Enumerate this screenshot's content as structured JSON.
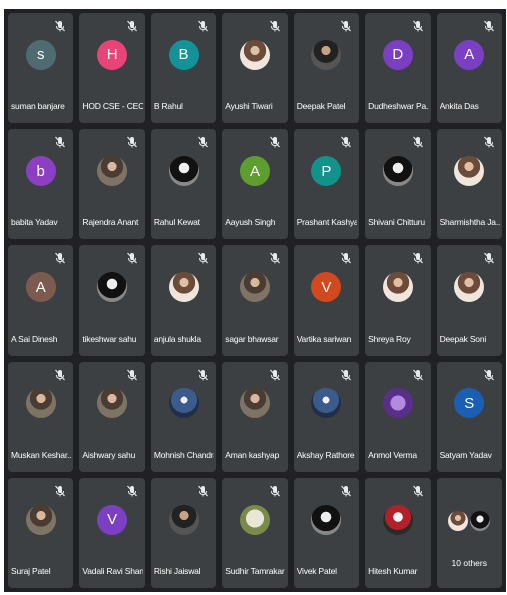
{
  "participants": [
    {
      "name": "suman banjare",
      "initial": "s",
      "color": "#4f6b72",
      "photo": ""
    },
    {
      "name": "HOD CSE - CEC",
      "initial": "H",
      "color": "#e8447a",
      "photo": ""
    },
    {
      "name": "B Rahul",
      "initial": "B",
      "color": "#12939a",
      "photo": ""
    },
    {
      "name": "Ayushi Tiwari",
      "initial": "",
      "color": "",
      "photo": "light"
    },
    {
      "name": "Deepak Patel",
      "initial": "",
      "color": "",
      "photo": "dark"
    },
    {
      "name": "Dudheshwar Pa...",
      "initial": "D",
      "color": "#7b3fc4",
      "photo": ""
    },
    {
      "name": "Ankita Das",
      "initial": "A",
      "color": "#7b3fc4",
      "photo": ""
    },
    {
      "name": "babita Yadav",
      "initial": "b",
      "color": "#8d3fc4",
      "photo": ""
    },
    {
      "name": "Rajendra Anant",
      "initial": "",
      "color": "",
      "photo": "photo"
    },
    {
      "name": "Rahul Kewat",
      "initial": "",
      "color": "",
      "photo": "bw"
    },
    {
      "name": "Aayush Singh",
      "initial": "A",
      "color": "#5e9e2f",
      "photo": ""
    },
    {
      "name": "Prashant Kashyap",
      "initial": "P",
      "color": "#12938a",
      "photo": ""
    },
    {
      "name": "Shivani Chitturu",
      "initial": "",
      "color": "",
      "photo": "bw"
    },
    {
      "name": "Sharmishtha Ja...",
      "initial": "",
      "color": "",
      "photo": "light"
    },
    {
      "name": "A Sai Dinesh",
      "initial": "A",
      "color": "#7d5a50",
      "photo": ""
    },
    {
      "name": "tikeshwar sahu",
      "initial": "",
      "color": "",
      "photo": "bw"
    },
    {
      "name": "anjula shukla",
      "initial": "",
      "color": "",
      "photo": "light"
    },
    {
      "name": "sagar bhawsar",
      "initial": "",
      "color": "",
      "photo": "photo"
    },
    {
      "name": "Vartika sariwan",
      "initial": "V",
      "color": "#d2491f",
      "photo": ""
    },
    {
      "name": "Shreya Roy",
      "initial": "",
      "color": "",
      "photo": "light"
    },
    {
      "name": "Deepak Soni",
      "initial": "",
      "color": "",
      "photo": "light"
    },
    {
      "name": "Muskan Keshar...",
      "initial": "",
      "color": "",
      "photo": "photo"
    },
    {
      "name": "Aishwary sahu",
      "initial": "",
      "color": "",
      "photo": "photo"
    },
    {
      "name": "Mohnish Chandra",
      "initial": "",
      "color": "",
      "photo": "blue"
    },
    {
      "name": "Aman kashyap",
      "initial": "",
      "color": "",
      "photo": "photo"
    },
    {
      "name": "Akshay Rathore",
      "initial": "",
      "color": "",
      "photo": "blue"
    },
    {
      "name": "Anmol Verma",
      "initial": "",
      "color": "",
      "photo": "purple"
    },
    {
      "name": "Satyam Yadav",
      "initial": "S",
      "color": "#1a5fb4",
      "photo": ""
    },
    {
      "name": "Suraj Patel",
      "initial": "",
      "color": "",
      "photo": "photo"
    },
    {
      "name": "Vadali Ravi Shan...",
      "initial": "V",
      "color": "#7b3fc4",
      "photo": ""
    },
    {
      "name": "Rishi Jaiswal",
      "initial": "",
      "color": "",
      "photo": "dark"
    },
    {
      "name": "Sudhir Tamrakar",
      "initial": "",
      "color": "",
      "photo": "sketch"
    },
    {
      "name": "Vivek Patel",
      "initial": "",
      "color": "",
      "photo": "bw"
    },
    {
      "name": "Hitesh Kumar",
      "initial": "",
      "color": "",
      "photo": "red"
    }
  ],
  "others": {
    "label": "10 others"
  },
  "icons": {
    "mic": "mic-off-icon"
  }
}
